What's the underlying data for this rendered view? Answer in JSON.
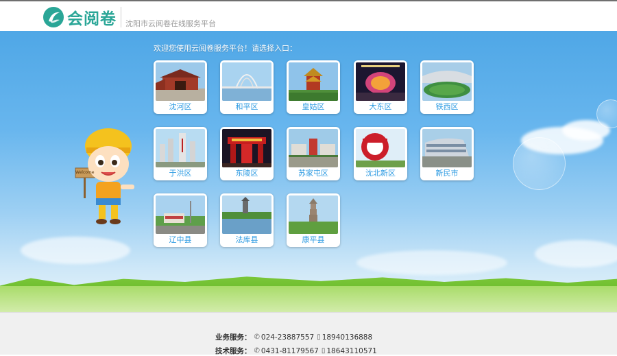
{
  "header": {
    "logo_text": "会阅卷",
    "tagline": "沈阳市云阅卷在线服务平台",
    "brand_color": "#2aa697"
  },
  "main": {
    "welcome": "欢迎您使用云阅卷服务平台！请选择入口：",
    "mascot_sign": "Welcome"
  },
  "districts": [
    {
      "label": "沈河区"
    },
    {
      "label": "和平区"
    },
    {
      "label": "皇姑区"
    },
    {
      "label": "大东区"
    },
    {
      "label": "铁西区"
    },
    {
      "label": "于洪区"
    },
    {
      "label": "东陵区"
    },
    {
      "label": "苏家屯区"
    },
    {
      "label": "沈北新区"
    },
    {
      "label": "新民市"
    },
    {
      "label": "辽中县"
    },
    {
      "label": "法库县"
    },
    {
      "label": "康平县"
    }
  ],
  "footer": {
    "business_label": "业务服务：",
    "business_phone": "024-23887557",
    "business_mobile": "18940136888",
    "tech_label": "技术服务：",
    "tech_phone": "0431-81179567",
    "tech_mobile": "18643110571"
  },
  "icons": {
    "phone": "phone-icon",
    "mobile": "mobile-icon"
  }
}
